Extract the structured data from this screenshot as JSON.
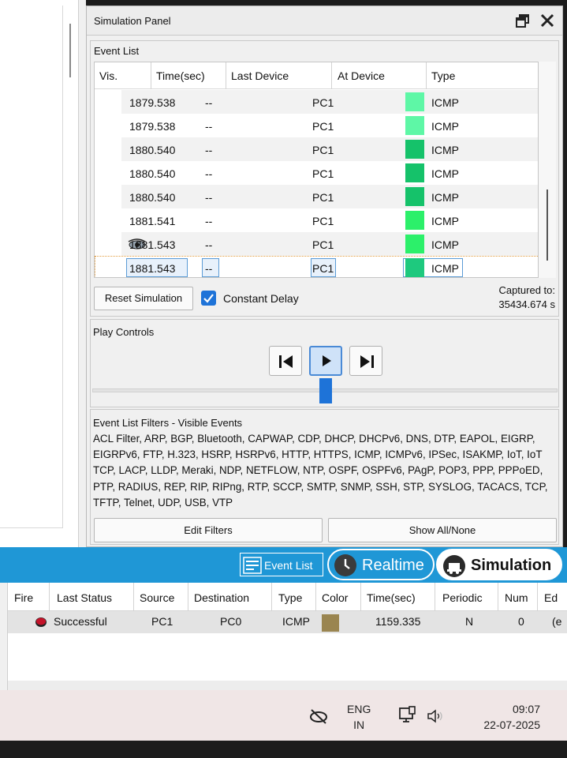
{
  "panel": {
    "title": "Simulation Panel",
    "event_list_label": "Event List",
    "columns": [
      "Vis.",
      "Time(sec)",
      "Last Device",
      "At Device",
      "Type"
    ],
    "rows": [
      {
        "time": "1879.538",
        "last": "--",
        "at": "PC1",
        "type": "ICMP",
        "color": "#5ef7a6",
        "eye": false
      },
      {
        "time": "1879.538",
        "last": "--",
        "at": "PC1",
        "type": "ICMP",
        "color": "#5ef7a6",
        "eye": false
      },
      {
        "time": "1880.540",
        "last": "--",
        "at": "PC1",
        "type": "ICMP",
        "color": "#15c26a",
        "eye": false
      },
      {
        "time": "1880.540",
        "last": "--",
        "at": "PC1",
        "type": "ICMP",
        "color": "#15c26a",
        "eye": false
      },
      {
        "time": "1880.540",
        "last": "--",
        "at": "PC1",
        "type": "ICMP",
        "color": "#15c26a",
        "eye": false
      },
      {
        "time": "1881.541",
        "last": "--",
        "at": "PC1",
        "type": "ICMP",
        "color": "#2cf06a",
        "eye": false
      },
      {
        "time": "1881.543",
        "last": "--",
        "at": "PC1",
        "type": "ICMP",
        "color": "#2cf06a",
        "eye": true
      },
      {
        "time": "1881.543",
        "last": "--",
        "at": "PC1",
        "type": "ICMP",
        "color": "#1ec97e",
        "eye": true
      }
    ],
    "reset_label": "Reset Simulation",
    "constant_delay_label": "Constant Delay",
    "captured_label": "Captured to:",
    "captured_value": "35434.674 s",
    "play_controls_label": "Play Controls",
    "filters_title": "Event List Filters - Visible Events",
    "filters_text": "ACL Filter, ARP, BGP, Bluetooth, CAPWAP, CDP, DHCP, DHCPv6, DNS, DTP, EAPOL, EIGRP, EIGRPv6, FTP, H.323, HSRP, HSRPv6, HTTP, HTTPS, ICMP, ICMPv6, IPSec, ISAKMP, IoT, IoT TCP, LACP, LLDP, Meraki, NDP, NETFLOW, NTP, OSPF, OSPFv6, PAgP, POP3, PPP, PPPoED, PTP, RADIUS, REP, RIP, RIPng, RTP, SCCP, SMTP, SNMP, SSH, STP, SYSLOG, TACACS, TCP, TFTP, Telnet, UDP, USB, VTP",
    "edit_filters_label": "Edit Filters",
    "show_all_label": "Show All/None"
  },
  "mode_bar": {
    "event_list": "Event List",
    "realtime": "Realtime",
    "simulation": "Simulation"
  },
  "pdu": {
    "columns": [
      "Fire",
      "Last Status",
      "Source",
      "Destination",
      "Type",
      "Color",
      "Time(sec)",
      "Periodic",
      "Num",
      "Ed"
    ],
    "row": {
      "status": "Successful",
      "source": "PC1",
      "destination": "PC0",
      "type": "ICMP",
      "color": "#9a8550",
      "time": "1159.335",
      "periodic": "N",
      "num": "0",
      "edit": "(e"
    }
  },
  "taskbar": {
    "lang": "ENG",
    "region": "IN",
    "time": "09:07",
    "date": "22-07-2025"
  },
  "colors": {
    "accent": "#1e73d8",
    "mode_bar": "#1f97d6"
  }
}
